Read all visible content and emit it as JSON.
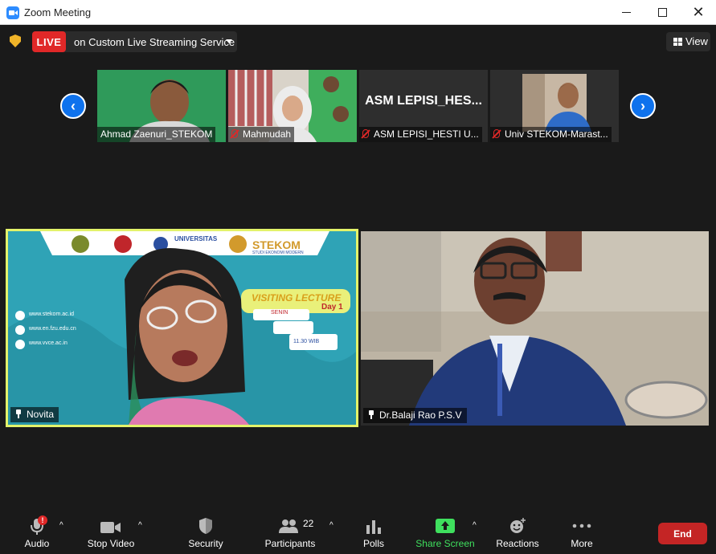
{
  "window": {
    "title": "Zoom Meeting"
  },
  "topbar": {
    "live_badge": "LIVE",
    "live_service": "on Custom Live Streaming Service",
    "view_label": "View"
  },
  "gallery": {
    "thumbnails": [
      {
        "name": "Ahmad Zaenuri_STEKOM",
        "muted": false
      },
      {
        "name": "Mahmudah",
        "muted": true
      },
      {
        "name": "ASM LEPISI_HESTI U...",
        "muted": true,
        "display_text": "ASM  LEPISI_HES..."
      },
      {
        "name": "Univ STEKOM-Marast...",
        "muted": true
      }
    ]
  },
  "tiles": {
    "left": {
      "name": "Novita",
      "banner": {
        "university": "UNIVERSITAS",
        "brand": "STEKOM",
        "brand_sub": "STUDI EKONOMI MODERN",
        "event": "VISITING LECTURE",
        "day": "Day 1",
        "weekday": "SENIN",
        "time": "11.30 WIB",
        "links": [
          "www.stekom.ac.id",
          "www.en.fzu.edu.cn",
          "www.vvce.ac.in"
        ]
      }
    },
    "right": {
      "name": "Dr.Balaji Rao P.S.V"
    }
  },
  "toolbar": {
    "audio": "Audio",
    "audio_alert": "!",
    "stop_video": "Stop Video",
    "security": "Security",
    "participants": "Participants",
    "participants_count": "22",
    "polls": "Polls",
    "share_screen": "Share Screen",
    "reactions": "Reactions",
    "more": "More",
    "end": "End"
  },
  "colors": {
    "accent_blue": "#0e72ed",
    "live_red": "#e02828",
    "end_red": "#c42525",
    "share_green": "#3fe05e",
    "active_speaker_border": "#e3f36a"
  }
}
